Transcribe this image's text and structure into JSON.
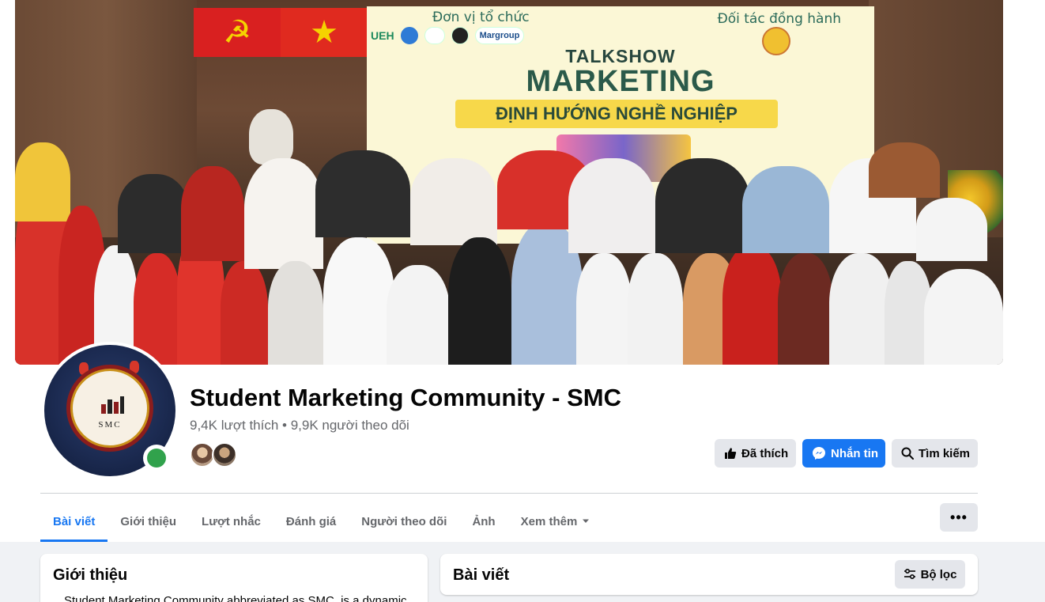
{
  "cover": {
    "banner_org_label": "Đơn vị tổ chức",
    "banner_partner_label": "Đối tác đồng hành",
    "banner_logo_text": "UEH",
    "banner_logo_2": "Margroup",
    "banner_talkshow": "TALKSHOW",
    "banner_main": "MARKETING",
    "banner_subtitle": "ĐỊNH HƯỚNG NGHỀ NGHIỆP"
  },
  "profile": {
    "name": "Student Marketing Community - SMC",
    "stats": "9,4K lượt thích • 9,9K người theo dõi",
    "avatar_text": "SMC",
    "online": true
  },
  "actions": {
    "liked": "Đã thích",
    "message": "Nhắn tin",
    "search": "Tìm kiếm"
  },
  "tabs": [
    {
      "label": "Bài viết",
      "active": true
    },
    {
      "label": "Giới thiệu",
      "active": false
    },
    {
      "label": "Lượt nhắc",
      "active": false
    },
    {
      "label": "Đánh giá",
      "active": false
    },
    {
      "label": "Người theo dõi",
      "active": false
    },
    {
      "label": "Ảnh",
      "active": false
    },
    {
      "label": "Xem thêm",
      "active": false
    }
  ],
  "more_button": "•••",
  "intro": {
    "title": "Giới thiệu",
    "text": "Student Marketing Community abbreviated as SMC, is a dynamic"
  },
  "posts": {
    "title": "Bài viết",
    "filter": "Bộ lọc"
  },
  "colors": {
    "accent": "#1877f2",
    "online": "#31a24c",
    "button_gray": "#e4e6eb",
    "secondary_text": "#65676b"
  },
  "icons": {
    "liked": "thumbs-up-icon",
    "message": "messenger-icon",
    "search": "search-icon",
    "more": "chevron-down-icon",
    "filter": "sliders-icon"
  }
}
